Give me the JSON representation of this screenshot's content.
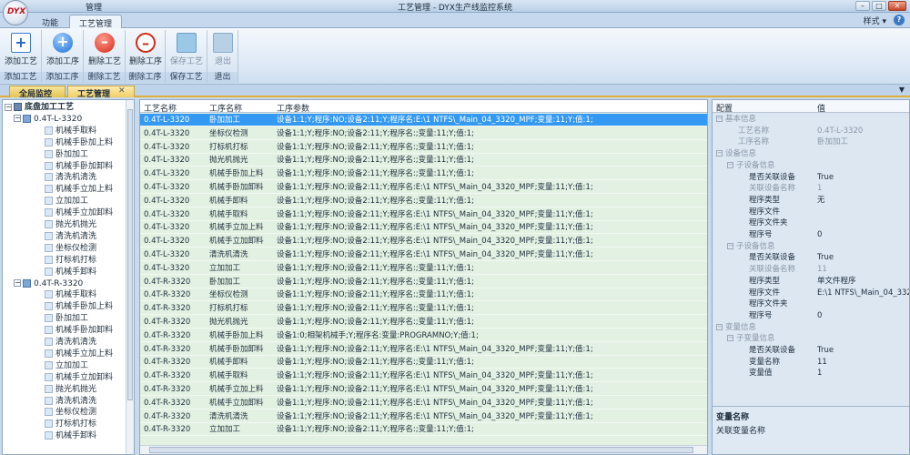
{
  "window": {
    "quick_title": "管理",
    "title": "工艺管理 - DYX生产线监控系统",
    "logo_text": "DYX"
  },
  "ribbon_tabs": [
    {
      "label": "功能"
    },
    {
      "label": "工艺管理"
    }
  ],
  "style_menu": "样式 ▾",
  "ribbon": {
    "groups": [
      {
        "label": "添加工艺",
        "button": "添加工艺",
        "icon": "add-process-icon"
      },
      {
        "label": "添加工序",
        "button": "添加工序",
        "icon": "add-step-icon"
      },
      {
        "label": "删除工艺",
        "button": "删除工艺",
        "icon": "delete-process-icon"
      },
      {
        "label": "删除工序",
        "button": "删除工序",
        "icon": "delete-step-icon"
      },
      {
        "label": "保存工艺",
        "button": "保存工艺",
        "icon": "save-icon"
      },
      {
        "label": "退出",
        "button": "退出",
        "icon": "exit-icon"
      }
    ]
  },
  "doc_tabs": [
    {
      "label": "全局监控"
    },
    {
      "label": "工艺管理"
    }
  ],
  "tree": {
    "root": "底盘加工工艺",
    "nodes": [
      {
        "label": "0.4T-L-3320",
        "children": [
          "机械手取料",
          "机械手卧加上料",
          "卧加加工",
          "机械手卧加卸料",
          "清洗机清洗",
          "机械手立加上料",
          "立加加工",
          "机械手立加卸料",
          "抛光机抛光",
          "清洗机清洗",
          "坐标仪检测",
          "打标机打标",
          "机械手卸料"
        ]
      },
      {
        "label": "0.4T-R-3320",
        "children": [
          "机械手取料",
          "机械手卧加上料",
          "卧加加工",
          "机械手卧加卸料",
          "清洗机清洗",
          "机械手立加上料",
          "立加加工",
          "机械手立加卸料",
          "抛光机抛光",
          "清洗机清洗",
          "坐标仪检测",
          "打标机打标",
          "机械手卸料"
        ]
      }
    ]
  },
  "grid": {
    "headers": [
      "工艺名称",
      "工序名称",
      "工序参数"
    ],
    "rows": [
      [
        "0.4T-L-3320",
        "卧加加工",
        "设备1:1;Y;程序:NO;设备2:11;Y;程序名:E:\\1 NTFS\\_Main_04_3320_MPF;变量:11;Y;值:1;"
      ],
      [
        "0.4T-L-3320",
        "坐标仪检测",
        "设备1:1;Y;程序:NO;设备2:11;Y;程序名:;变量:11;Y;值:1;"
      ],
      [
        "0.4T-L-3320",
        "打标机打标",
        "设备1:1;Y;程序:NO;设备2:11;Y;程序名:;变量:11;Y;值:1;"
      ],
      [
        "0.4T-L-3320",
        "抛光机抛光",
        "设备1:1;Y;程序:NO;设备2:11;Y;程序名:;变量:11;Y;值:1;"
      ],
      [
        "0.4T-L-3320",
        "机械手卧加上料",
        "设备1:1;Y;程序:NO;设备2:11;Y;程序名:;变量:11;Y;值:1;"
      ],
      [
        "0.4T-L-3320",
        "机械手卧加卸料",
        "设备1:1;Y;程序:NO;设备2:11;Y;程序名:E:\\1 NTFS\\_Main_04_3320_MPF;变量:11;Y;值:1;"
      ],
      [
        "0.4T-L-3320",
        "机械手卸料",
        "设备1:1;Y;程序:NO;设备2:11;Y;程序名:;变量:11;Y;值:1;"
      ],
      [
        "0.4T-L-3320",
        "机械手取料",
        "设备1:1;Y;程序:NO;设备2:11;Y;程序名:E:\\1 NTFS\\_Main_04_3320_MPF;变量:11;Y;值:1;"
      ],
      [
        "0.4T-L-3320",
        "机械手立加上料",
        "设备1:1;Y;程序:NO;设备2:11;Y;程序名:E:\\1 NTFS\\_Main_04_3320_MPF;变量:11;Y;值:1;"
      ],
      [
        "0.4T-L-3320",
        "机械手立加卸料",
        "设备1:1;Y;程序:NO;设备2:11;Y;程序名:E:\\1 NTFS\\_Main_04_3320_MPF;变量:11;Y;值:1;"
      ],
      [
        "0.4T-L-3320",
        "清洗机清洗",
        "设备1:1;Y;程序:NO;设备2:11;Y;程序名:E:\\1 NTFS\\_Main_04_3320_MPF;变量:11;Y;值:1;"
      ],
      [
        "0.4T-L-3320",
        "立加加工",
        "设备1:1;Y;程序:NO;设备2:11;Y;程序名:;变量:11;Y;值:1;"
      ],
      [
        "0.4T-R-3320",
        "卧加加工",
        "设备1:1;Y;程序:NO;设备2:11;Y;程序名:;变量:11;Y;值:1;"
      ],
      [
        "0.4T-R-3320",
        "坐标仪检测",
        "设备1:1;Y;程序:NO;设备2:11;Y;程序名:;变量:11;Y;值:1;"
      ],
      [
        "0.4T-R-3320",
        "打标机打标",
        "设备1:1;Y;程序:NO;设备2:11;Y;程序名:;变量:11;Y;值:1;"
      ],
      [
        "0.4T-R-3320",
        "抛光机抛光",
        "设备1:1;Y;程序:NO;设备2:11;Y;程序名:;变量:11;Y;值:1;"
      ],
      [
        "0.4T-R-3320",
        "机械手卧加上料",
        "设备1:0;相架机械手;Y;程序名:变量:PROGRAMNO;Y;值:1;"
      ],
      [
        "0.4T-R-3320",
        "机械手卧加卸料",
        "设备1:1;Y;程序:NO;设备2:11;Y;程序名:E:\\1 NTFS\\_Main_04_3320_MPF;变量:11;Y;值:1;"
      ],
      [
        "0.4T-R-3320",
        "机械手卸料",
        "设备1:1;Y;程序:NO;设备2:11;Y;程序名:;变量:11;Y;值:1;"
      ],
      [
        "0.4T-R-3320",
        "机械手取料",
        "设备1:1;Y;程序:NO;设备2:11;Y;程序名:E:\\1 NTFS\\_Main_04_3320_MPF;变量:11;Y;值:1;"
      ],
      [
        "0.4T-R-3320",
        "机械手立加上料",
        "设备1:1;Y;程序:NO;设备2:11;Y;程序名:E:\\1 NTFS\\_Main_04_3320_MPF;变量:11;Y;值:1;"
      ],
      [
        "0.4T-R-3320",
        "机械手立加卸料",
        "设备1:1;Y;程序:NO;设备2:11;Y;程序名:E:\\1 NTFS\\_Main_04_3320_MPF;变量:11;Y;值:1;"
      ],
      [
        "0.4T-R-3320",
        "清洗机清洗",
        "设备1:1;Y;程序:NO;设备2:11;Y;程序名:E:\\1 NTFS\\_Main_04_3320_MPF;变量:11;Y;值:1;"
      ],
      [
        "0.4T-R-3320",
        "立加加工",
        "设备1:1;Y;程序:NO;设备2:11;Y;程序名:;变量:11;Y;值:1;"
      ]
    ],
    "selected_row": 0
  },
  "props": {
    "headers": [
      "配置",
      "值"
    ],
    "rows": [
      {
        "k": "基本信息",
        "v": "",
        "level": 0,
        "type": "cat"
      },
      {
        "k": "工艺名称",
        "v": "0.4T-L-3320",
        "level": 1,
        "type": "muted"
      },
      {
        "k": "工序名称",
        "v": "卧加加工",
        "level": 1,
        "type": "muted"
      },
      {
        "k": "设备信息",
        "v": "",
        "level": 0,
        "type": "cat"
      },
      {
        "k": "子设备信息",
        "v": "",
        "level": 1,
        "type": "cat"
      },
      {
        "k": "是否关联设备",
        "v": "True",
        "level": 2,
        "type": ""
      },
      {
        "k": "关联设备名称",
        "v": "1",
        "level": 2,
        "type": "muted"
      },
      {
        "k": "程序类型",
        "v": "无",
        "level": 2,
        "type": ""
      },
      {
        "k": "程序文件",
        "v": "",
        "level": 2,
        "type": ""
      },
      {
        "k": "程序文件夹",
        "v": "",
        "level": 2,
        "type": ""
      },
      {
        "k": "程序号",
        "v": "0",
        "level": 2,
        "type": ""
      },
      {
        "k": "子设备信息",
        "v": "",
        "level": 1,
        "type": "cat"
      },
      {
        "k": "是否关联设备",
        "v": "True",
        "level": 2,
        "type": ""
      },
      {
        "k": "关联设备名称",
        "v": "11",
        "level": 2,
        "type": "muted"
      },
      {
        "k": "程序类型",
        "v": "单文件程序",
        "level": 2,
        "type": ""
      },
      {
        "k": "程序文件",
        "v": "E:\\1 NTFS\\_Main_04_3320...",
        "level": 2,
        "type": ""
      },
      {
        "k": "程序文件夹",
        "v": "",
        "level": 2,
        "type": ""
      },
      {
        "k": "程序号",
        "v": "0",
        "level": 2,
        "type": ""
      },
      {
        "k": "变量信息",
        "v": "",
        "level": 0,
        "type": "cat"
      },
      {
        "k": "子变量信息",
        "v": "",
        "level": 1,
        "type": "cat"
      },
      {
        "k": "是否关联设备",
        "v": "True",
        "level": 2,
        "type": ""
      },
      {
        "k": "变量名称",
        "v": "11",
        "level": 2,
        "type": ""
      },
      {
        "k": "变量值",
        "v": "1",
        "level": 2,
        "type": ""
      }
    ],
    "desc_title": "变量名称",
    "desc_text": "关联变量名称"
  }
}
